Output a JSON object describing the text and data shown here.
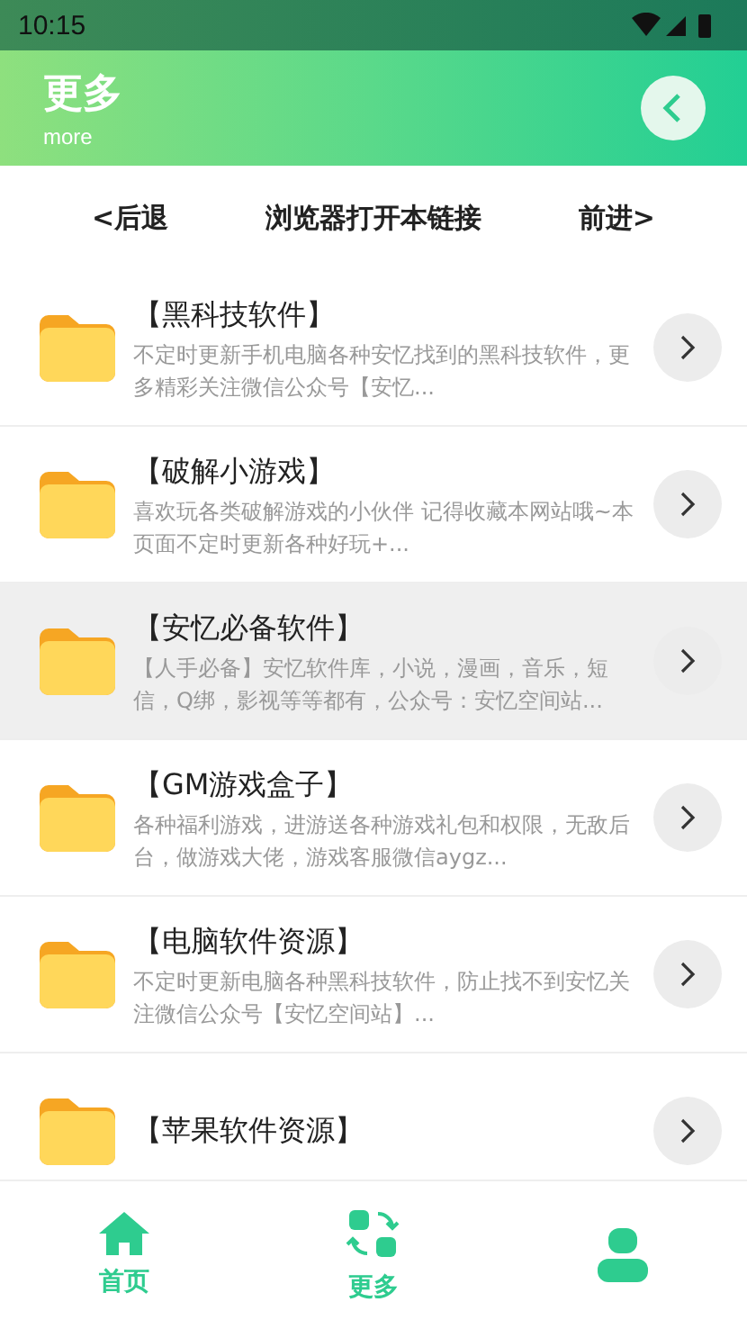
{
  "status_bar": {
    "time": "10:15"
  },
  "header": {
    "title": "更多",
    "subtitle": "more"
  },
  "link_bar": [
    "<后退",
    "浏览器打开本链接",
    "前进>"
  ],
  "items": [
    {
      "title": "【黑科技软件】",
      "description": "不定时更新手机电脑各种安忆找到的黑科技软件，更多精彩关注微信公众号【安忆...",
      "selected": false
    },
    {
      "title": "【破解小游戏】",
      "description": "喜欢玩各类破解游戏的小伙伴 记得收藏本网站哦~本页面不定时更新各种好玩+...",
      "selected": false
    },
    {
      "title": "【安忆必备软件】",
      "description": "【人手必备】安忆软件库，小说，漫画，音乐，短信，Q绑，影视等等都有，公众号：安忆空间站...",
      "selected": true
    },
    {
      "title": "【GM游戏盒子】",
      "description": "各种福利游戏，进游送各种游戏礼包和权限，无敌后台，做游戏大佬，游戏客服微信aygz...",
      "selected": false
    },
    {
      "title": "【电脑软件资源】",
      "description": "不定时更新电脑各种黑科技软件，防止找不到安忆关注微信公众号【安忆空间站】...",
      "selected": false
    },
    {
      "title": "【苹果软件资源】",
      "selected": false
    }
  ],
  "tab_bar": [
    {
      "kind": "home",
      "label": "首页"
    },
    {
      "kind": "more",
      "label": "更多"
    },
    {
      "kind": "person"
    }
  ]
}
